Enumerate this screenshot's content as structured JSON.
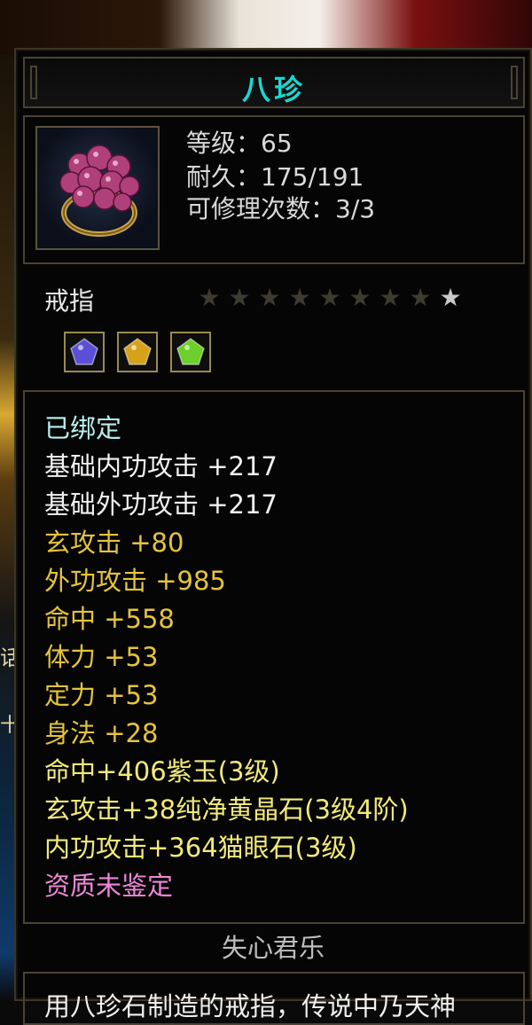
{
  "item": {
    "name": "八珍",
    "level": "等级：65",
    "durability": "耐久：175/191",
    "repairs": "可修理次数：3/3",
    "type": "戒指",
    "stars_total": 9,
    "stars_lit": 1
  },
  "gems": [
    {
      "name": "purple-gem-icon",
      "color": "#5a4fd6"
    },
    {
      "name": "yellow-crystal-gem-icon",
      "color": "#d6a21a"
    },
    {
      "name": "cats-eye-gem-icon",
      "color": "#6ccf2a"
    }
  ],
  "stats": [
    {
      "text": "已绑定",
      "color": "cyan"
    },
    {
      "text": "基础内功攻击  +217",
      "color": "white"
    },
    {
      "text": "基础外功攻击  +217",
      "color": "white"
    },
    {
      "text": "玄攻击  +80",
      "color": "gold"
    },
    {
      "text": "外功攻击  +985",
      "color": "gold"
    },
    {
      "text": "命中  +558",
      "color": "gold"
    },
    {
      "text": "体力  +53",
      "color": "gold"
    },
    {
      "text": "定力  +53",
      "color": "gold"
    },
    {
      "text": "身法  +28",
      "color": "gold"
    },
    {
      "text": "命中+406紫玉(3级)",
      "color": "yellow"
    },
    {
      "text": "玄攻击+38纯净黄晶石(3级4阶)",
      "color": "yellow"
    },
    {
      "text": "内功攻击+364猫眼石(3级)",
      "color": "yellow"
    },
    {
      "text": "资质未鉴定",
      "color": "pink"
    }
  ],
  "designer": "失心君乐",
  "description": "用八珍石制造的戒指，传说中乃天神",
  "colors": {
    "title": "#17d8d2",
    "frame": "#4a4333",
    "cyan": "#b8f0f0",
    "white": "#f2f2f2",
    "gold": "#e5c43a",
    "yellow": "#f2ea7a",
    "pink": "#ee86d8"
  }
}
